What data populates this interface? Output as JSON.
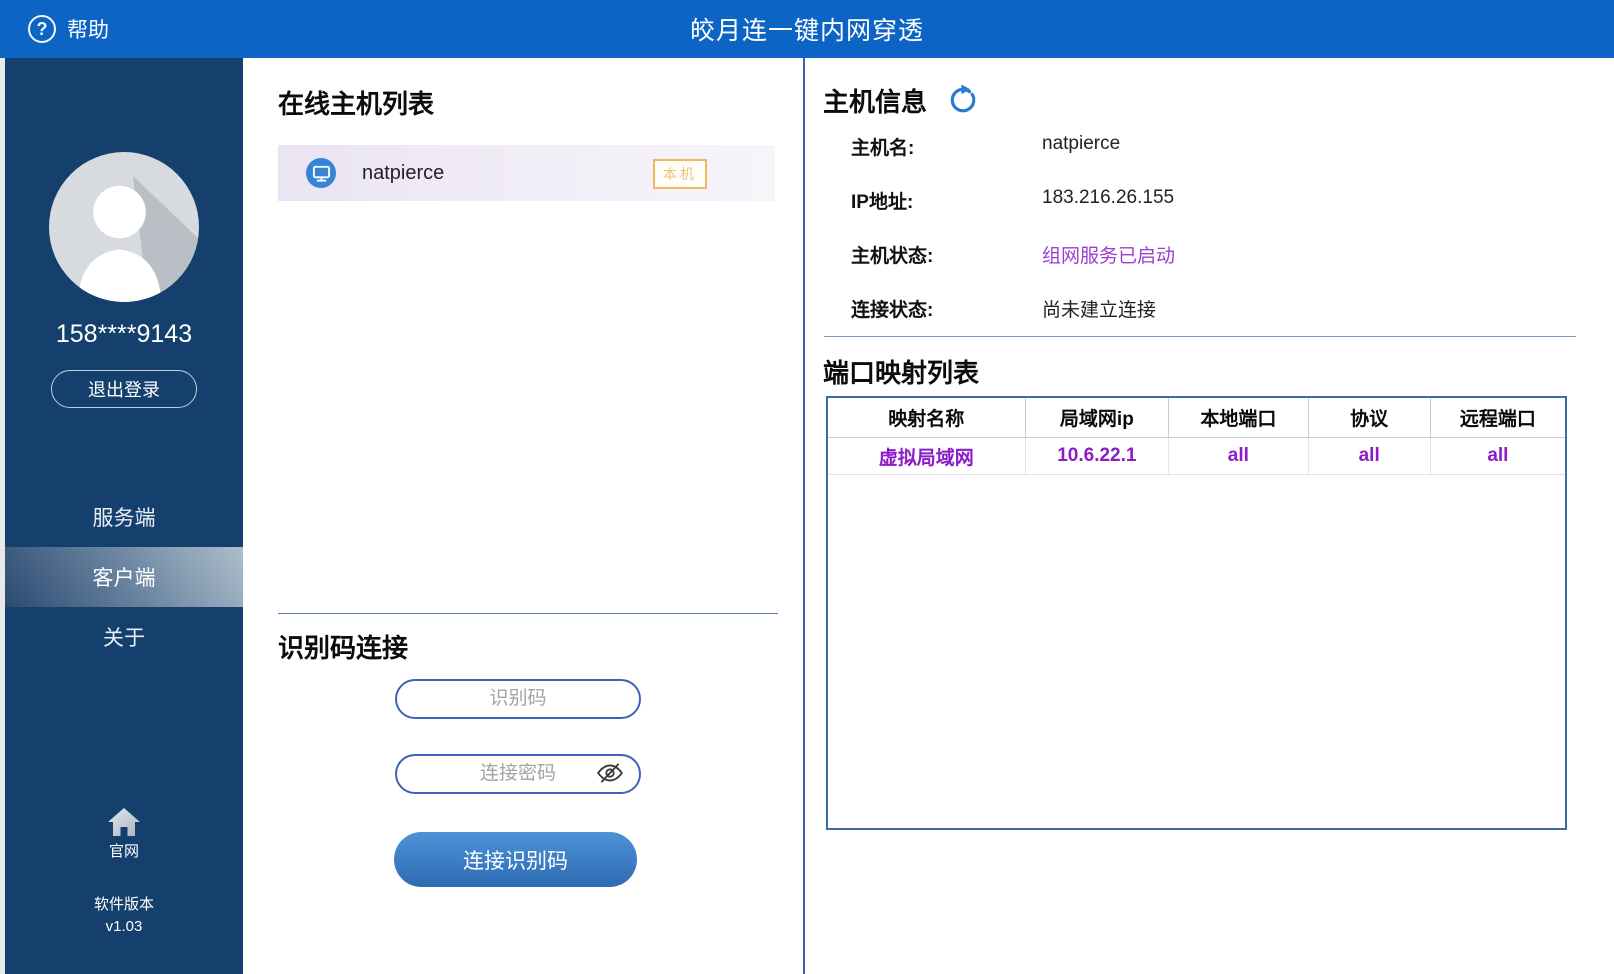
{
  "topbar": {
    "help_label": "帮助",
    "title": "皎月连一键内网穿透"
  },
  "sidebar": {
    "phone": "158****9143",
    "logout_label": "退出登录",
    "menu": [
      {
        "label": "服务端",
        "active": false
      },
      {
        "label": "客户端",
        "active": true
      },
      {
        "label": "关于",
        "active": false
      }
    ],
    "website_label": "官网",
    "version_label": "软件版本",
    "version": "v1.03"
  },
  "host_list": {
    "title": "在线主机列表",
    "items": [
      {
        "name": "natpierce",
        "badge": "本机"
      }
    ]
  },
  "id_connect": {
    "title": "识别码连接",
    "code_placeholder": "识别码",
    "password_placeholder": "连接密码",
    "button_label": "连接识别码"
  },
  "host_info": {
    "title": "主机信息",
    "rows": [
      {
        "label": "主机名:",
        "value": "natpierce"
      },
      {
        "label": "IP地址:",
        "value": "183.216.26.155"
      },
      {
        "label": "主机状态:",
        "value": "组网服务已启动"
      },
      {
        "label": "连接状态:",
        "value": "尚未建立连接"
      }
    ]
  },
  "port_mapping": {
    "title": "端口映射列表",
    "headers": [
      "映射名称",
      "局域网ip",
      "本地端口",
      "协议",
      "远程端口"
    ],
    "rows": [
      [
        "虚拟局域网",
        "10.6.22.1",
        "all",
        "all",
        "all"
      ]
    ]
  },
  "icons": {
    "help_glyph": "?"
  },
  "colors": {
    "topbar_blue": "#0c64c4",
    "sidebar_navy": "#15406d",
    "accent_purple": "#8b1cc7",
    "status_purple": "#9a3fd1",
    "badge_orange": "#ecba60",
    "button_blue": "#3a7cc4",
    "table_border_blue": "#3e6ca6"
  }
}
